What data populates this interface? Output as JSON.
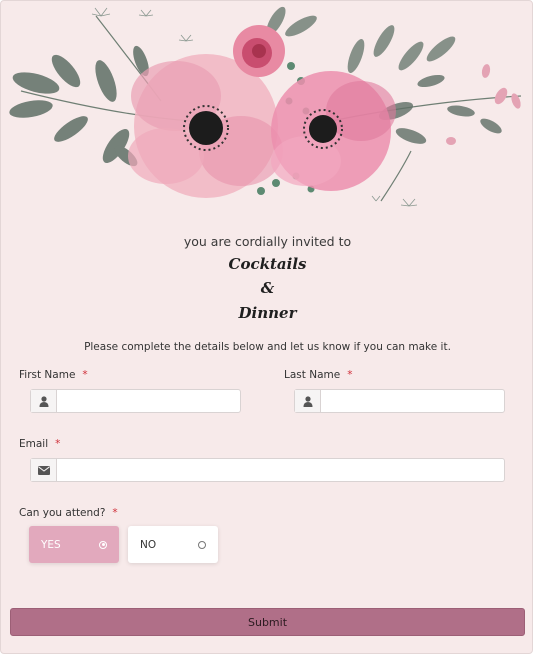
{
  "invitation": {
    "intro": "you are cordially invited to",
    "line1": "Cocktails",
    "line2": "&",
    "line3": "Dinner",
    "subtitle": "Please complete the details below and let us know if you can make it."
  },
  "form": {
    "first_name": {
      "label": "First Name",
      "required_mark": "*",
      "value": ""
    },
    "last_name": {
      "label": "Last Name",
      "required_mark": "*",
      "value": ""
    },
    "email": {
      "label": "Email",
      "required_mark": "*",
      "value": ""
    },
    "attend": {
      "label": "Can you attend?",
      "required_mark": "*",
      "options": [
        {
          "label": "YES",
          "selected": true
        },
        {
          "label": "NO",
          "selected": false
        }
      ]
    },
    "submit_label": "Submit"
  },
  "colors": {
    "background": "#f7eaea",
    "selected_option": "#e2a9bd",
    "submit_button": "#b06f88",
    "required": "#d0303a"
  },
  "icons": [
    "floral-decoration",
    "user-icon",
    "envelope-icon",
    "radio-checked-icon",
    "radio-unchecked-icon"
  ]
}
